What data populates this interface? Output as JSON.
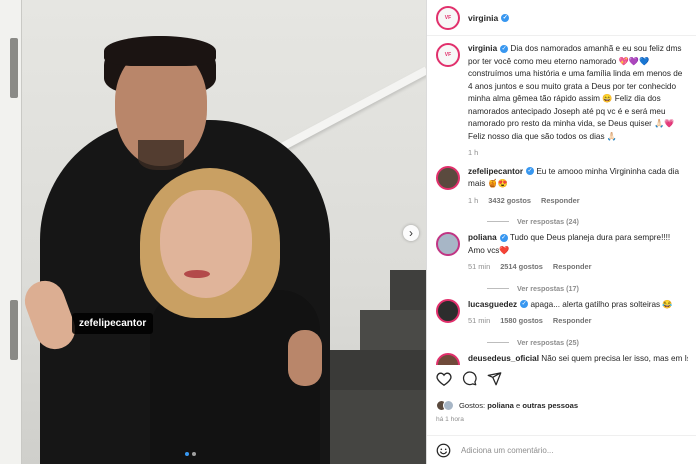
{
  "post": {
    "author": "virginia",
    "photo_tag": "zefelipecantor",
    "caption": "Dia dos namorados amanhã e eu sou feliz dms por ter você como meu eterno namorado 💖💜💙 construímos uma história e uma família linda em menos de 4 anos juntos e sou muito grata a Deus por ter conhecido minha alma gêmea tão rápido assim 😄 Feliz dia dos namorados antecipado Joseph até pq vc é e será meu namorado pro resto da minha vida, se Deus quiser 🙏🏻💗 Feliz nosso dia que são todos os dias 🙏🏻",
    "caption_time": "1 h"
  },
  "comments": [
    {
      "username": "zefelipecantor",
      "text": "Eu te amooo minha Virgininha cada dia mais 🍯😍",
      "time": "1 h",
      "likes": "3432 gostos",
      "reply_label": "Responder",
      "view_replies": "Ver respostas (24)"
    },
    {
      "username": "poliana",
      "text": "Tudo que Deus planeja dura para sempre!!!! Amo vcs❤️",
      "time": "51 min",
      "likes": "2514 gostos",
      "reply_label": "Responder",
      "view_replies": "Ver respostas (17)"
    },
    {
      "username": "lucasguedez",
      "text": "apaga... alerta gatilho pras solteiras 😂",
      "time": "51 min",
      "likes": "1580 gostos",
      "reply_label": "Responder",
      "view_replies": "Ver respostas (25)"
    },
    {
      "username": "deusedeus_oficial",
      "text": "Não sei quem precisa ler isso, mas em Isaías"
    }
  ],
  "likes_line": {
    "prefix": "Gostos:",
    "user": "poliana",
    "joiner": "e",
    "rest": "outras pessoas"
  },
  "posted_time": "há 1 hora",
  "comment_input": {
    "placeholder": "Adiciona um comentário..."
  },
  "icons": {
    "like": "heart-outline-icon",
    "comment": "comment-bubble-icon",
    "share": "paper-plane-icon",
    "emoji": "smiley-icon",
    "next": "chevron-right-icon"
  },
  "colors": {
    "verified": "#3897f0",
    "story_ring": "#e1306c"
  }
}
